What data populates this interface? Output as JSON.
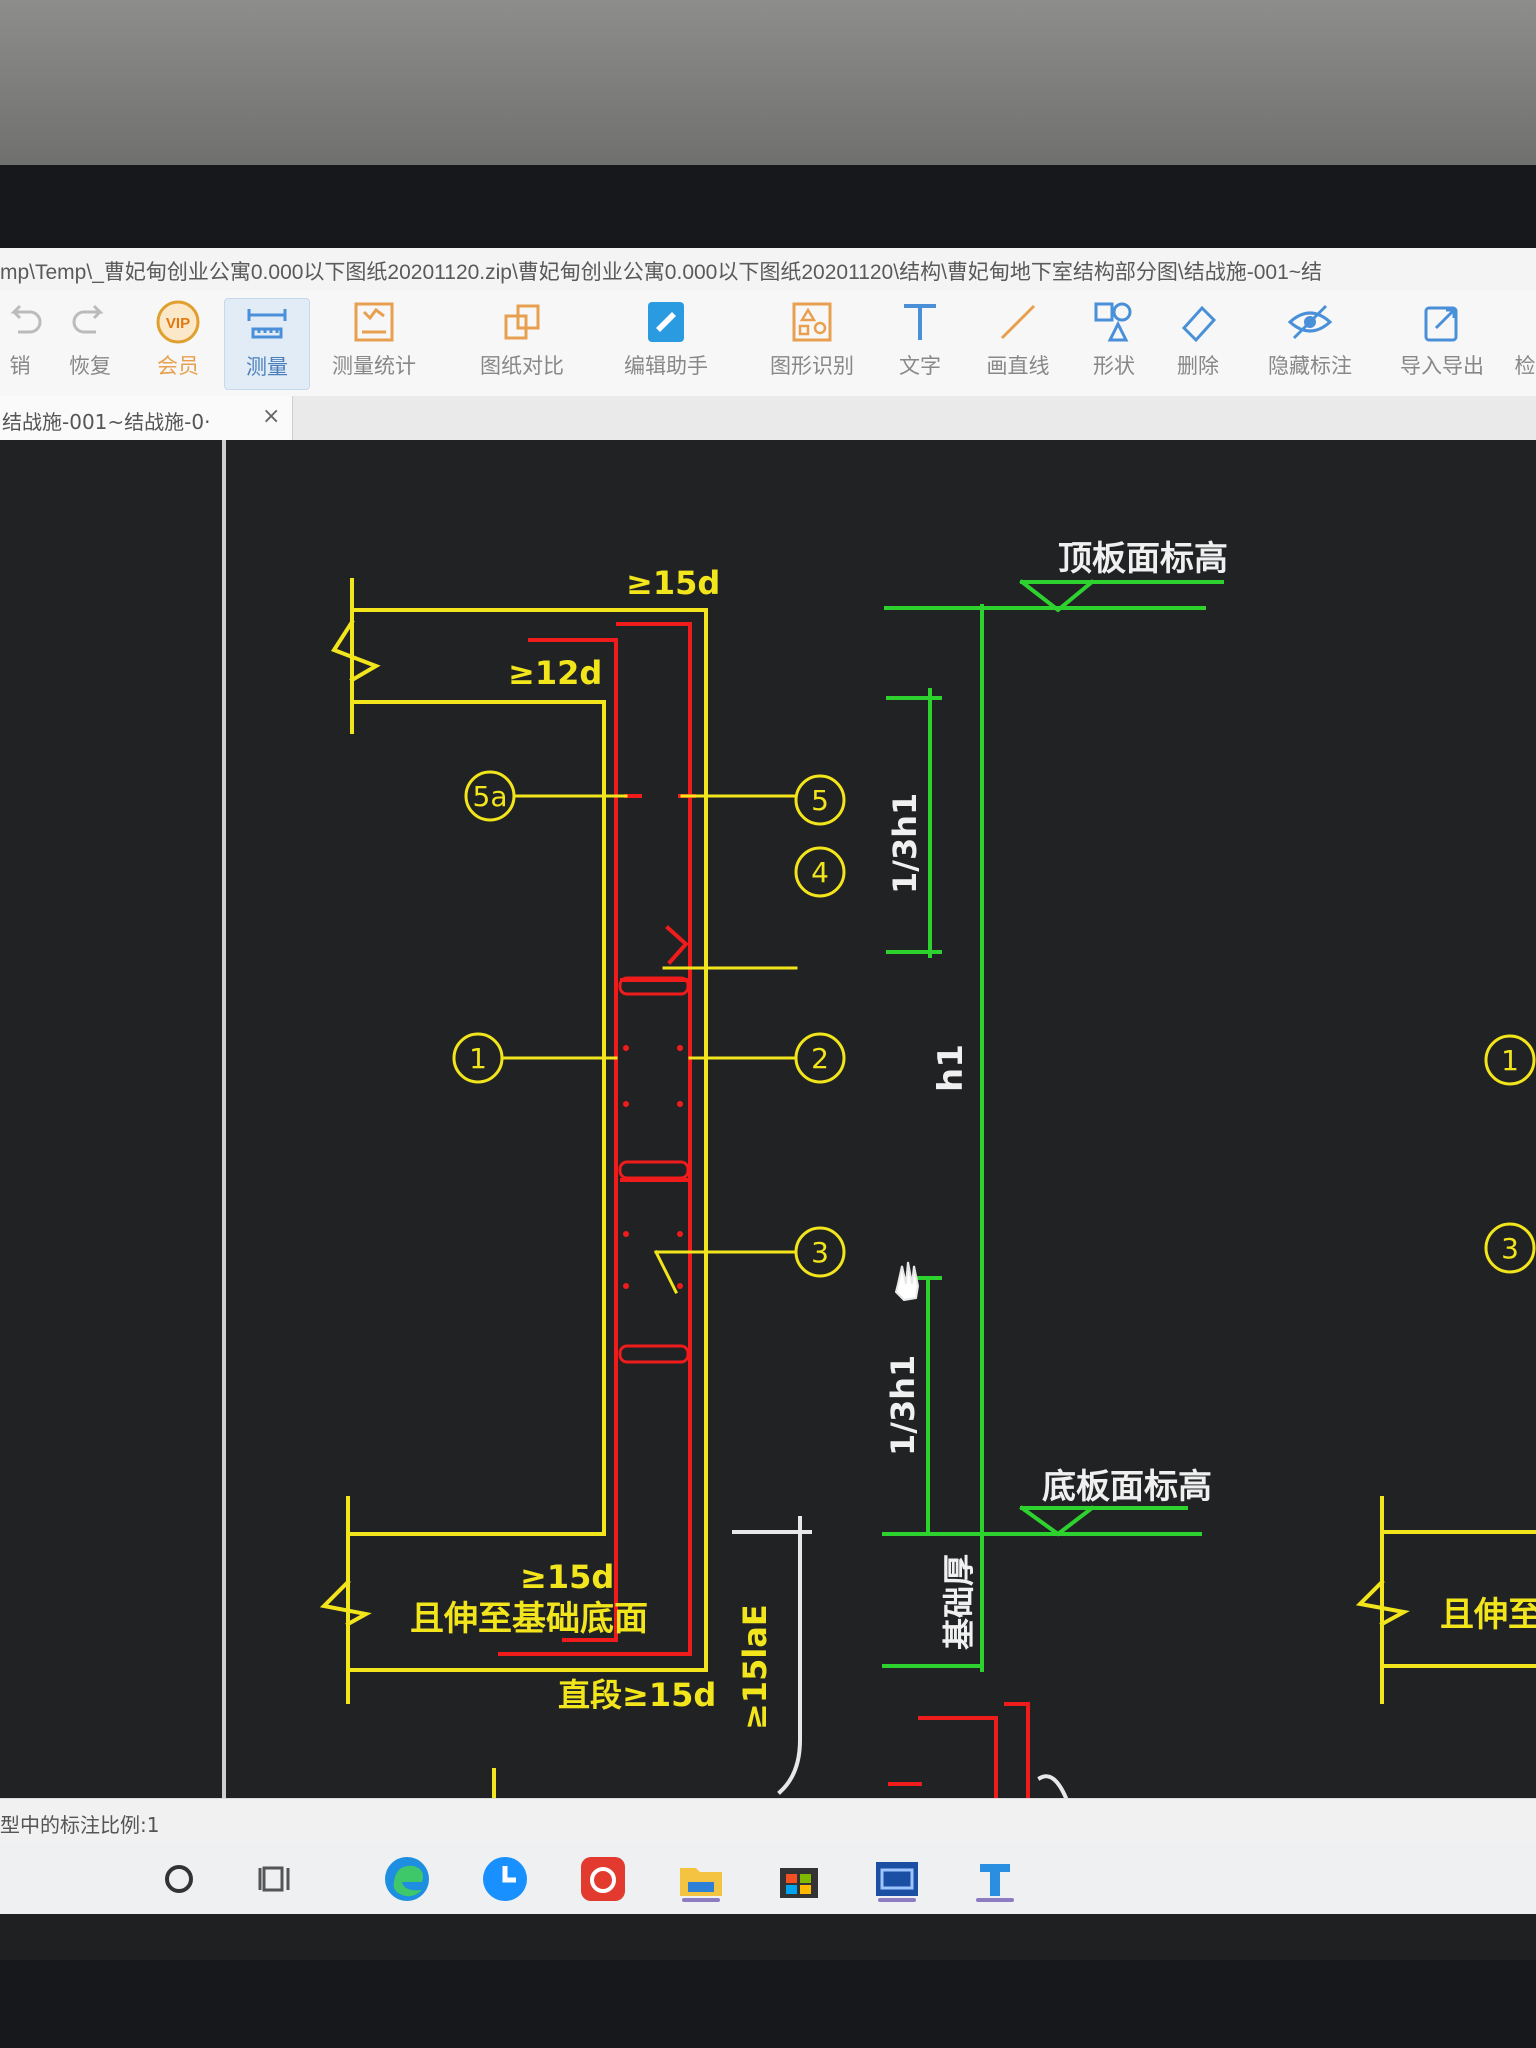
{
  "window": {
    "path": "mp\\Temp\\_曹妃甸创业公寓0.000以下图纸20201120.zip\\曹妃甸创业公寓0.000以下图纸20201120\\结构\\曹妃甸地下室结构部分图\\结战施-001~结"
  },
  "toolbar": {
    "items": [
      {
        "label": "销",
        "icon": "undo-icon"
      },
      {
        "label": "恢复",
        "icon": "redo-icon"
      },
      {
        "label": "会员",
        "icon": "vip-icon"
      },
      {
        "label": "测量",
        "icon": "ruler-icon"
      },
      {
        "label": "测量统计",
        "icon": "measure-stats-icon"
      },
      {
        "label": "图纸对比",
        "icon": "compare-icon"
      },
      {
        "label": "编辑助手",
        "icon": "edit-assistant-icon"
      },
      {
        "label": "图形识别",
        "icon": "shape-recognize-icon"
      },
      {
        "label": "文字",
        "icon": "text-icon"
      },
      {
        "label": "画直线",
        "icon": "line-icon"
      },
      {
        "label": "形状",
        "icon": "shapes-icon"
      },
      {
        "label": "删除",
        "icon": "eraser-icon"
      },
      {
        "label": "隐藏标注",
        "icon": "hide-annotation-icon"
      },
      {
        "label": "导入导出",
        "icon": "import-export-icon"
      },
      {
        "label": "检",
        "icon": "more-icon"
      }
    ],
    "active_index": 3,
    "vip_text": "VIP",
    "accent": "#4a90d9"
  },
  "tab": {
    "label": "结战施-001~结战施-0·",
    "close": "×"
  },
  "drawing": {
    "colors": {
      "yellow": "#f2e51c",
      "red": "#f01b1b",
      "green": "#2ed22e",
      "white": "#e8e8e8"
    },
    "labels": {
      "top_15d": "≥15d",
      "top_12d": "≥12d",
      "bottom_15d": "≥15d",
      "extend_text": "且伸至基础底面",
      "straight_15d": "直段≥15d",
      "lae": "≥15laE",
      "top_elev": "顶板面标高",
      "bottom_elev": "底板面标高",
      "third_top": "1/3h1",
      "h1": "h1",
      "third_bottom": "1/3h1",
      "base_thk": "基础厚",
      "right_extend": "且伸至基础"
    },
    "markers": {
      "m5a": "5a",
      "m5": "5",
      "m4": "4",
      "m1": "1",
      "m2": "2",
      "m3": "3",
      "right1": "1",
      "right3": "3"
    }
  },
  "statusbar": {
    "text": "型中的标注比例:1"
  },
  "taskbar": {
    "icons": [
      "cortana-search-icon",
      "task-view-icon",
      "edge-icon",
      "clock-app-icon",
      "netease-music-icon",
      "file-explorer-icon",
      "store-icon",
      "cad-app-icon",
      "t-app-icon"
    ]
  }
}
